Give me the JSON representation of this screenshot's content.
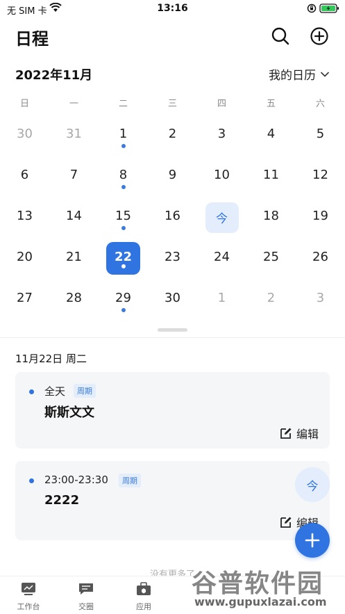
{
  "status": {
    "carrier": "无 SIM 卡",
    "time": "13:16"
  },
  "header": {
    "title": "日程"
  },
  "month": {
    "label": "2022年11月",
    "calendar_selector": "我的日历"
  },
  "weekdays": [
    "日",
    "一",
    "二",
    "三",
    "四",
    "五",
    "六"
  ],
  "weeks": [
    [
      {
        "d": "30",
        "m": true
      },
      {
        "d": "31",
        "m": true
      },
      {
        "d": "1",
        "dot": true
      },
      {
        "d": "2"
      },
      {
        "d": "3"
      },
      {
        "d": "4"
      },
      {
        "d": "5"
      }
    ],
    [
      {
        "d": "6"
      },
      {
        "d": "7"
      },
      {
        "d": "8",
        "dot": true
      },
      {
        "d": "9"
      },
      {
        "d": "10"
      },
      {
        "d": "11"
      },
      {
        "d": "12"
      }
    ],
    [
      {
        "d": "13"
      },
      {
        "d": "14"
      },
      {
        "d": "15",
        "dot": true
      },
      {
        "d": "16"
      },
      {
        "d": "今",
        "today": true
      },
      {
        "d": "18"
      },
      {
        "d": "19"
      }
    ],
    [
      {
        "d": "20"
      },
      {
        "d": "21"
      },
      {
        "d": "22",
        "dot": true,
        "selected": true
      },
      {
        "d": "23"
      },
      {
        "d": "24"
      },
      {
        "d": "25"
      },
      {
        "d": "26"
      }
    ],
    [
      {
        "d": "27"
      },
      {
        "d": "28"
      },
      {
        "d": "29",
        "dot": true
      },
      {
        "d": "30"
      },
      {
        "d": "1",
        "m": true
      },
      {
        "d": "2",
        "m": true
      },
      {
        "d": "3",
        "m": true
      }
    ]
  ],
  "events": {
    "day_label": "11月22日  周二",
    "items": [
      {
        "time": "全天",
        "tag": "周期",
        "title": "斯斯文文",
        "edit": "编辑"
      },
      {
        "time": "23:00-23:30",
        "tag": "周期",
        "title": "2222",
        "edit": "编辑"
      }
    ],
    "empty_text": "没有更多了"
  },
  "fab": {
    "today": "今"
  },
  "tabs": [
    {
      "label": "工作台",
      "icon": "workbench-icon"
    },
    {
      "label": "交圈",
      "icon": "chat-icon"
    },
    {
      "label": "应用",
      "icon": "apps-icon"
    }
  ],
  "watermark": {
    "cn": "谷普软件园",
    "url": "www.gupuxlazai.com"
  },
  "colors": {
    "accent": "#2f74e0",
    "today_bg": "#e3edfb",
    "card_bg": "#f5f6f8"
  }
}
